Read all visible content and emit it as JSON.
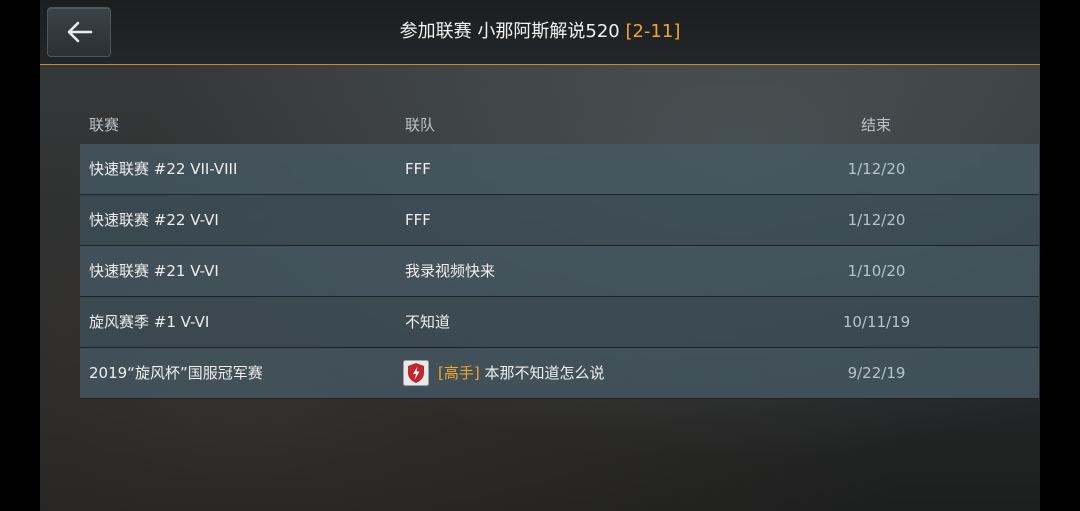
{
  "header": {
    "title": "参加联赛 小那阿斯解说520",
    "range": "[2-11]",
    "back_icon": "arrow-left-icon"
  },
  "columns": {
    "league": "联赛",
    "clan": "联队",
    "end": "结束"
  },
  "rows": [
    {
      "league": "快速联赛 #22 VII-VIII",
      "clan": "FFF",
      "end": "1/12/20"
    },
    {
      "league": "快速联赛 #22 V-VI",
      "clan": "FFF",
      "end": "1/12/20"
    },
    {
      "league": "快速联赛 #21 V-VI",
      "clan": "我录视频快来",
      "end": "1/10/20"
    },
    {
      "league": "旋风赛季 #1 V-VI",
      "clan": "不知道",
      "end": "10/11/19"
    },
    {
      "league": "2019“旋风杯”国服冠军赛",
      "clan_tag": "[高手]",
      "clan": " 本那不知道怎么说",
      "end": "9/22/19",
      "clan_icon": "shield-lightning-icon"
    }
  ],
  "colors": {
    "accent": "#f0a431",
    "row_bg": "#465a64",
    "icon_red": "#c0282d"
  }
}
